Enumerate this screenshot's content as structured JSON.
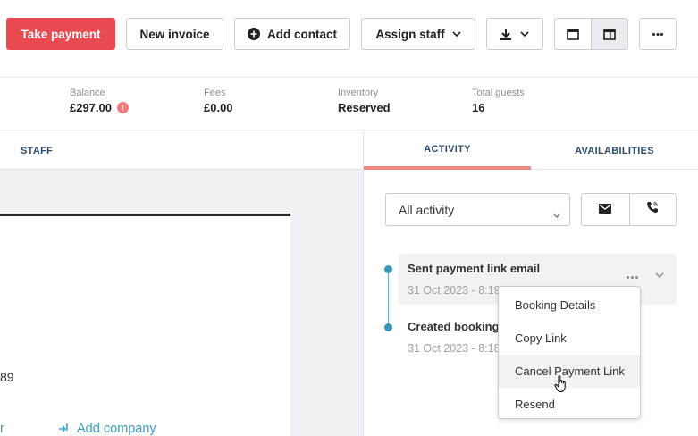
{
  "toolbar": {
    "take_payment": "Take payment",
    "new_invoice": "New invoice",
    "add_contact": "Add contact",
    "assign_staff": "Assign staff"
  },
  "summary": {
    "balance_label": "Balance",
    "balance_value": "£297.00",
    "balance_alert": "!",
    "fees_label": "Fees",
    "fees_value": "£0.00",
    "inventory_label": "Inventory",
    "inventory_value": "Reserved",
    "guests_label": "Total guests",
    "guests_value": "16"
  },
  "left": {
    "tab": "STAFF",
    "number_fragment": "89",
    "link_fragment": "r",
    "add_company": "Add company"
  },
  "right": {
    "tabs": [
      "ACTIVITY",
      "AVAILABILITIES"
    ],
    "filter_value": "All activity",
    "activities": [
      {
        "title": "Sent payment link email",
        "time": "31 Oct 2023 - 8:19"
      },
      {
        "title": "Created booking",
        "time": "31 Oct 2023 - 8:18"
      }
    ],
    "menu": [
      "Booking Details",
      "Copy Link",
      "Cancel Payment Link",
      "Resend"
    ]
  },
  "colors": {
    "primary": "#e84a4f",
    "active_tab": "#ee8a84",
    "link": "#3b9bc9",
    "timeline": "#3a96b6"
  },
  "icons": {
    "add_contact": "plus-circle-icon",
    "download": "download-icon",
    "single_panel": "single-panel-icon",
    "split_panel": "split-panel-icon",
    "more": "more-icon",
    "email": "email-icon",
    "phone": "phone-icon"
  }
}
